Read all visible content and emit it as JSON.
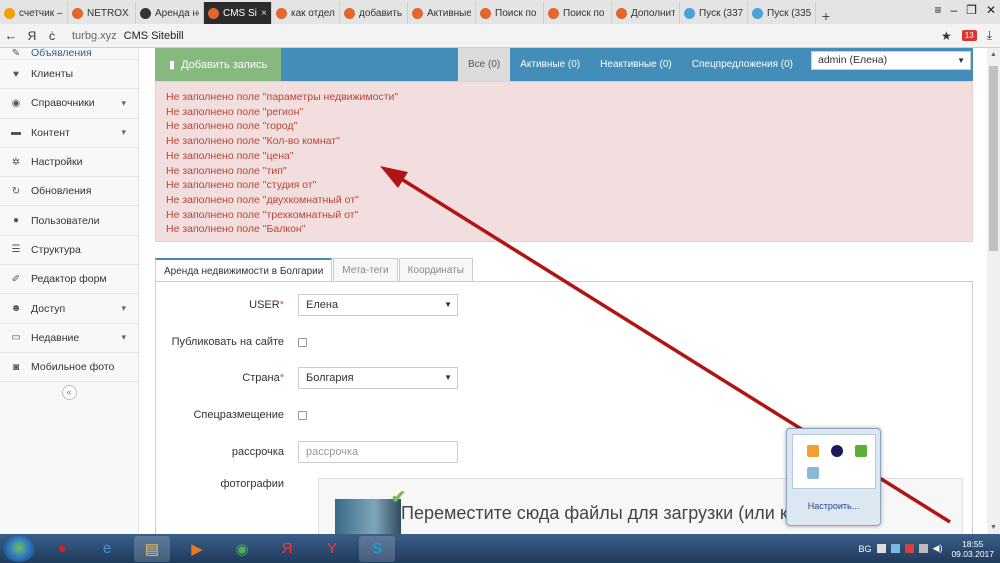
{
  "browser": {
    "tabs": [
      {
        "label": "счетчик –",
        "color": "#f5a000"
      },
      {
        "label": "NETROX -",
        "color": "#e2672a"
      },
      {
        "label": "Аренда не",
        "color": "#333333"
      },
      {
        "label": "CMS Sit",
        "color": "#e2672a",
        "active": true
      },
      {
        "label": "как отдел",
        "color": "#e2672a"
      },
      {
        "label": "добавить",
        "color": "#e2672a"
      },
      {
        "label": "Активные",
        "color": "#e2672a"
      },
      {
        "label": "Поиск по",
        "color": "#e2672a"
      },
      {
        "label": "Поиск по",
        "color": "#e2672a"
      },
      {
        "label": "Дополнит",
        "color": "#e2672a"
      },
      {
        "label": "Пуск (337",
        "color": "#4aa3d8"
      },
      {
        "label": "Пуск (335",
        "color": "#4aa3d8"
      }
    ],
    "tab_close": "×",
    "new_tab": "+",
    "window_controls": {
      "menu": "≡",
      "min": "‒",
      "max": "❐",
      "close": "✕"
    },
    "back": "←",
    "yandex": "Я",
    "reload": "ċ",
    "url": "turbg.xyz",
    "page_title": "CMS Sitebill",
    "star": "★",
    "download": "⤓",
    "ext_badge": "13"
  },
  "sidebar": {
    "items": [
      {
        "label": "Объявления",
        "icon": "pencil-square-icon",
        "glyph": "✎",
        "chev": ""
      },
      {
        "label": "Клиенты",
        "icon": "heart-icon",
        "glyph": "♥",
        "chev": ""
      },
      {
        "label": "Справочники",
        "icon": "globe-icon",
        "glyph": "◉",
        "chev": "▾"
      },
      {
        "label": "Контент",
        "icon": "desktop-icon",
        "glyph": "▬",
        "chev": "▾"
      },
      {
        "label": "Настройки",
        "icon": "cog-icon",
        "glyph": "✲",
        "chev": ""
      },
      {
        "label": "Обновления",
        "icon": "refresh-icon",
        "glyph": "↻",
        "chev": ""
      },
      {
        "label": "Пользователи",
        "icon": "user-icon",
        "glyph": "●",
        "chev": ""
      },
      {
        "label": "Структура",
        "icon": "list-icon",
        "glyph": "☰",
        "chev": ""
      },
      {
        "label": "Редактор форм",
        "icon": "edit-icon",
        "glyph": "✐",
        "chev": ""
      },
      {
        "label": "Доступ",
        "icon": "group-icon",
        "glyph": "☻",
        "chev": "▾"
      },
      {
        "label": "Недавние",
        "icon": "laptop-icon",
        "glyph": "▭",
        "chev": "▾"
      },
      {
        "label": "Мобильное фото",
        "icon": "camera-icon",
        "glyph": "◙",
        "chev": ""
      }
    ],
    "collapse": "«"
  },
  "topnav": {
    "add_label": "Добавить запись",
    "add_icon": "▮",
    "filters": [
      {
        "label": "Все (0)",
        "active": true
      },
      {
        "label": "Активные (0)"
      },
      {
        "label": "Неактивные (0)"
      },
      {
        "label": "Спецпредложения (0)"
      }
    ],
    "user_select": "admin (Елена)"
  },
  "errors": [
    "Не заполнено поле \"параметры недвижимости\"",
    "Не заполнено поле \"регион\"",
    "Не заполнено поле \"город\"",
    "Не заполнено поле \"Кол-во комнат\"",
    "Не заполнено поле \"цена\"",
    "Не заполнено поле \"тип\"",
    "Не заполнено поле \"студия от\"",
    "Не заполнено поле \"двухкомнатный от\"",
    "Не заполнено поле \"трехкомнатный от\"",
    "Не заполнено поле \"Балкон\""
  ],
  "form_tabs": [
    "Аренда недвижимости в Болгарии",
    "Мета-теги",
    "Координаты"
  ],
  "form": {
    "user_label": "USER",
    "user_value": "Елена",
    "publish_label": "Публиковать на сайте",
    "country_label": "Страна",
    "country_value": "Болгария",
    "special_label": "Спецразмещение",
    "installment_label": "рассрочка",
    "installment_placeholder": "рассрочка",
    "photos_label": "фотографии",
    "dropzone_text": "Переместите сюда файлы для загрузки (или кликните)",
    "required_mark": "*"
  },
  "tray_popup": {
    "configure": "Настроить..."
  },
  "taskbar": {
    "lang": "BG",
    "time": "18:55",
    "date": "09.03.2017",
    "apps": [
      {
        "name": "microphone-app",
        "glyph": "●",
        "color": "#d42020"
      },
      {
        "name": "internet-explorer-app",
        "glyph": "e",
        "color": "#3b9ae0"
      },
      {
        "name": "file-explorer-app",
        "glyph": "▤",
        "color": "#e8c35a"
      },
      {
        "name": "media-player-app",
        "glyph": "▶",
        "color": "#e87a1a"
      },
      {
        "name": "chrome-app",
        "glyph": "◉",
        "color": "#4caf50"
      },
      {
        "name": "yandex-app",
        "glyph": "Я",
        "color": "#ff3333"
      },
      {
        "name": "yandex-browser-app",
        "glyph": "Y",
        "color": "#ff3333"
      },
      {
        "name": "skype-app",
        "glyph": "S",
        "color": "#00aff0"
      }
    ]
  }
}
